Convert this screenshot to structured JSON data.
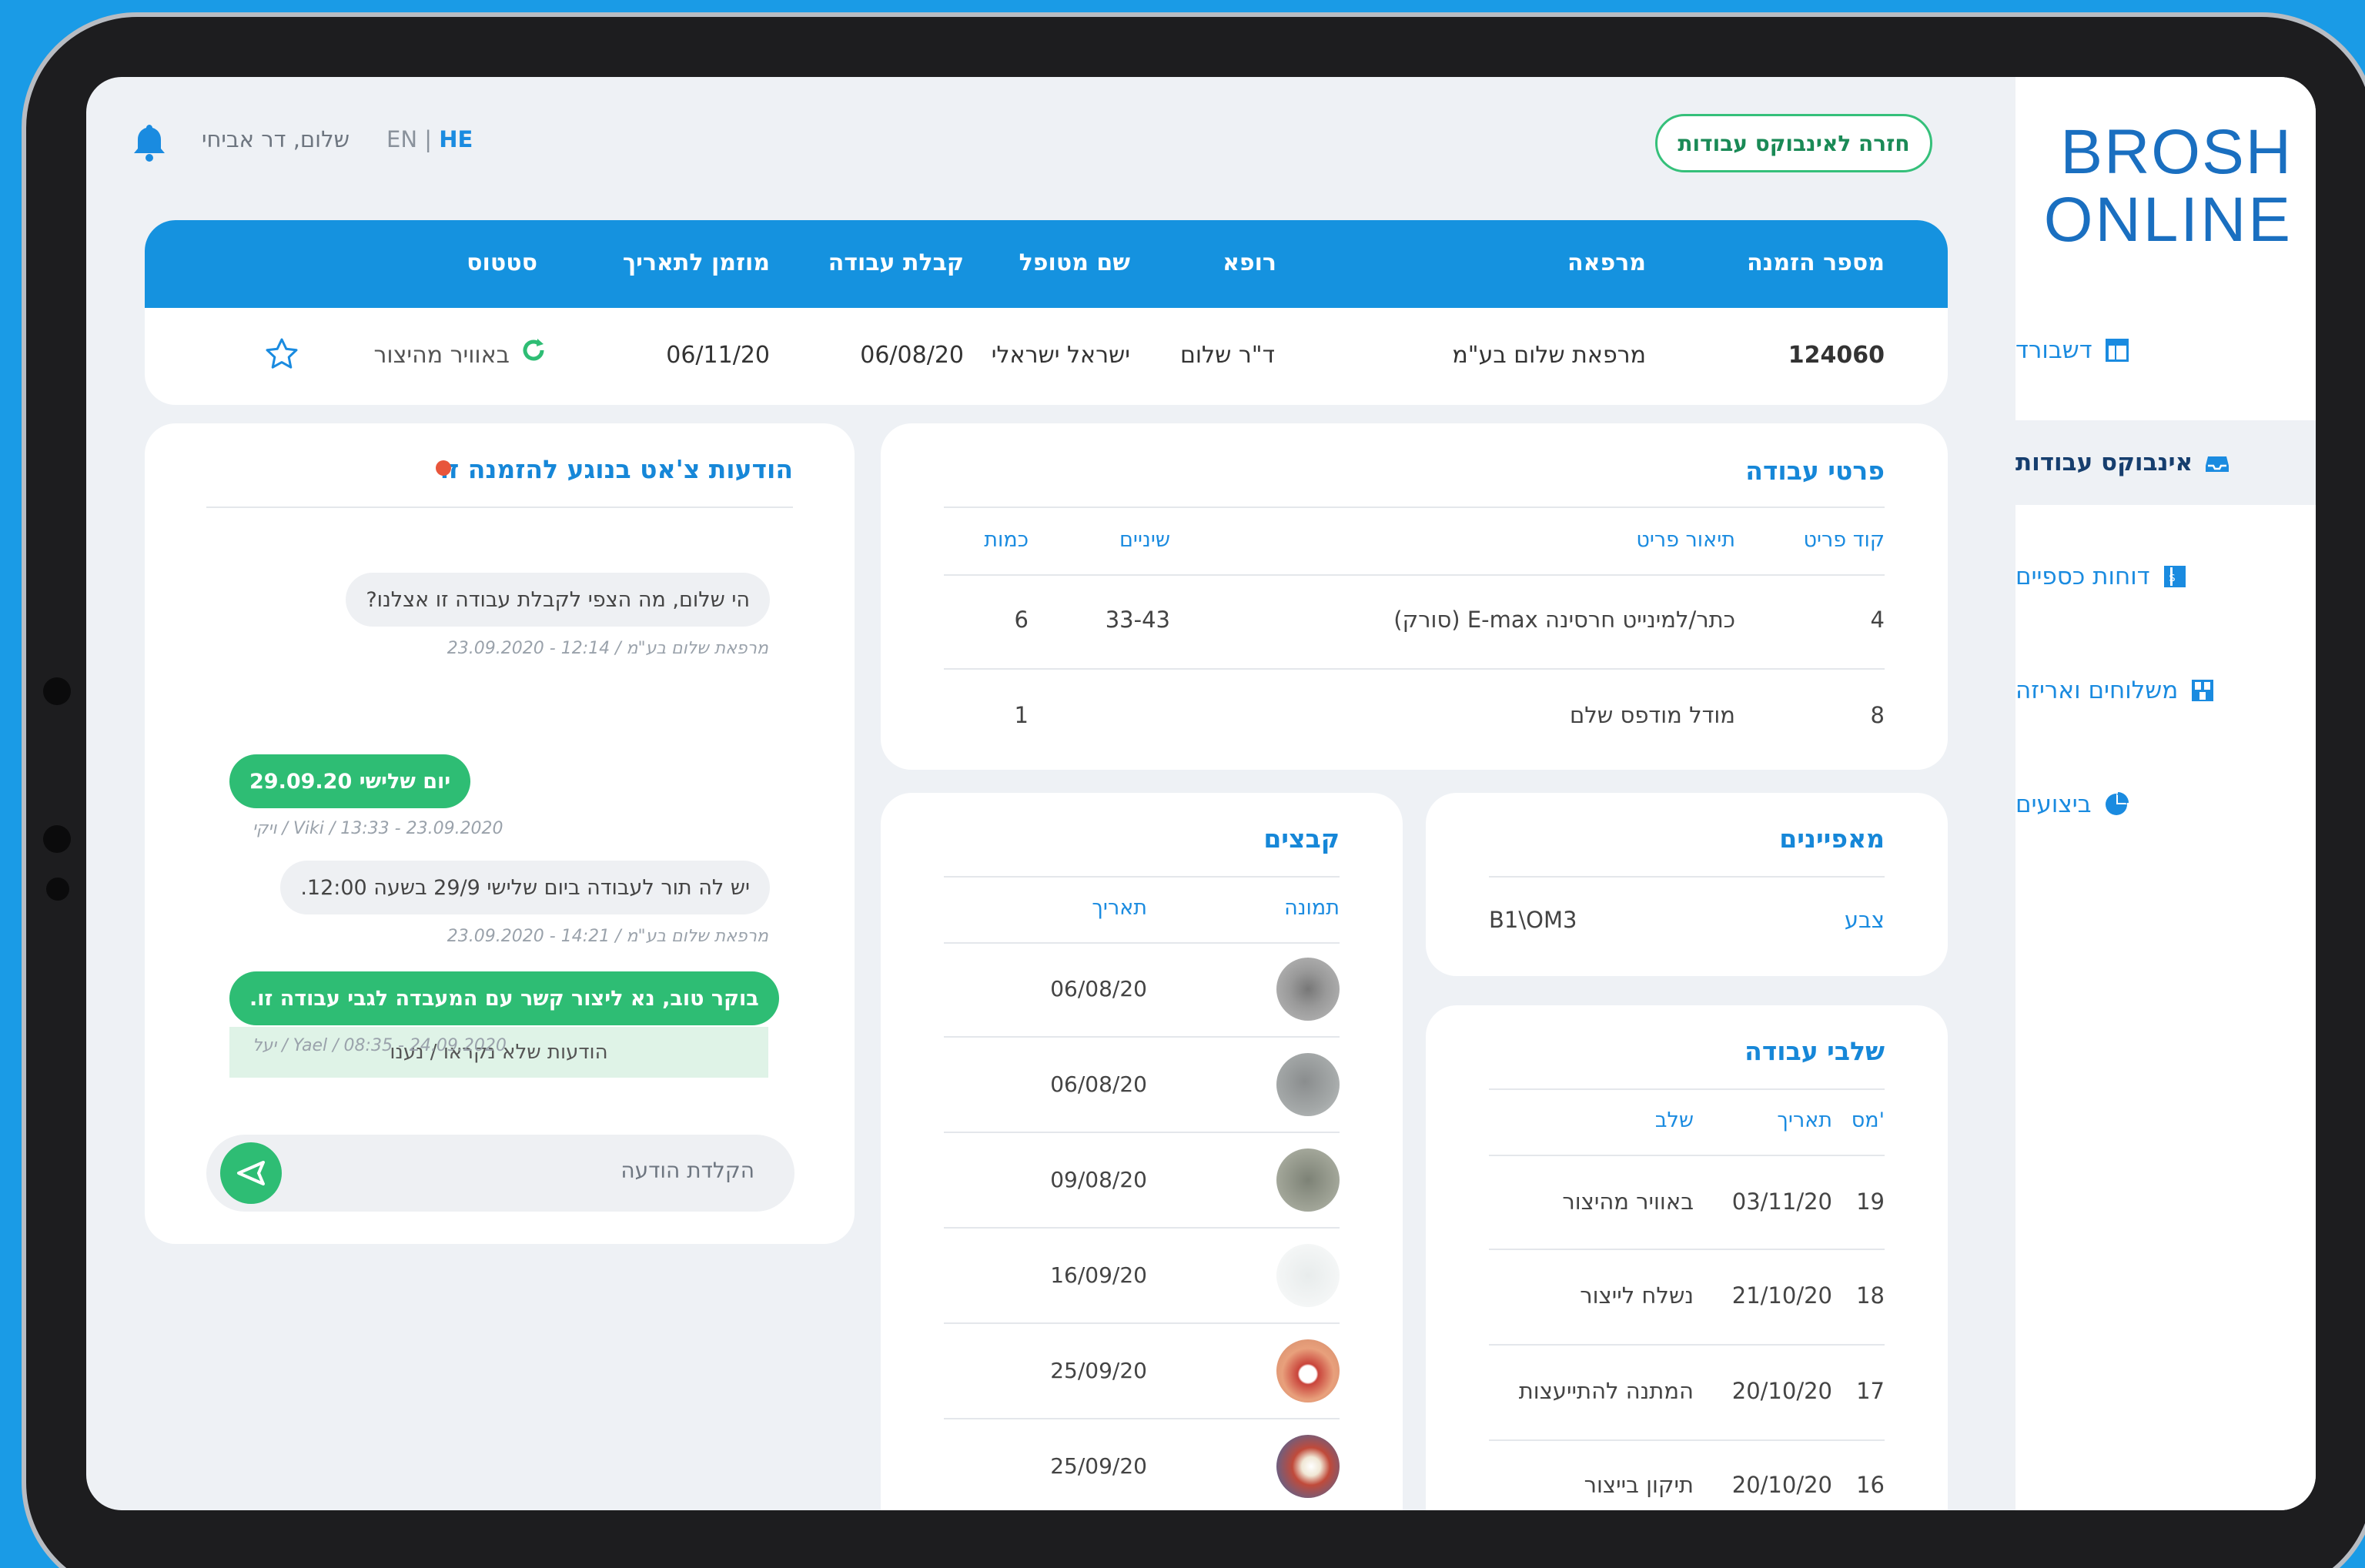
{
  "brand": {
    "line1": "BROSH",
    "line2": "ONLINE"
  },
  "sidebar": {
    "items": [
      {
        "label": "דשבורד",
        "icon": "dashboard-icon"
      },
      {
        "label": "אינבוקס עבודות",
        "icon": "inbox-icon"
      },
      {
        "label": "דוחות כספיים",
        "icon": "finance-report-icon"
      },
      {
        "label": "משלוחים ואריזה",
        "icon": "package-icon"
      },
      {
        "label": "ביצועים",
        "icon": "pie-chart-icon"
      }
    ]
  },
  "header": {
    "back_button": "חזרה לאינבוקס עבודות",
    "greeting": "שלום,  דר אביחי",
    "lang_en": "EN",
    "lang_sep": "|",
    "lang_he": "HE"
  },
  "order": {
    "columns": [
      "מספר הזמנה",
      "מרפאה",
      "רופא",
      "שם מטופל",
      "קבלת עבודה",
      "מוזמן לתאריך",
      "סטטוס"
    ],
    "order_number": "124060",
    "clinic": "מרפאת שלום בע\"מ",
    "doctor": "ד\"ר שלום",
    "patient": "ישראל ישראלי",
    "received": "06/08/20",
    "due": "06/11/20",
    "status": "באוויר מהיצור"
  },
  "work_details": {
    "title": "פרטי עבודה",
    "columns": [
      "קוד פריט",
      "תיאור פריט",
      "שיניים",
      "כמות"
    ],
    "rows": [
      {
        "code": "4",
        "desc": "כתר/למינייט חרסינה E-max (סורק)",
        "teeth": "33-43",
        "qty": "6"
      },
      {
        "code": "8",
        "desc": "מודל מודפס שלם",
        "teeth": "",
        "qty": "1"
      }
    ]
  },
  "properties": {
    "title": "מאפיינים",
    "label": "צבע",
    "value": "B1\\OM3"
  },
  "files": {
    "title": "קבצים",
    "columns": [
      "תמונה",
      "תאריך"
    ],
    "rows": [
      "06/08/20",
      "06/08/20",
      "09/08/20",
      "16/09/20",
      "25/09/20",
      "25/09/20"
    ]
  },
  "stages": {
    "title": "שלבי עבודה",
    "columns": [
      "מס'",
      "תאריך",
      "שלב"
    ],
    "rows": [
      {
        "num": "19",
        "date": "03/11/20",
        "stage": "באוויר מהיצור"
      },
      {
        "num": "18",
        "date": "21/10/20",
        "stage": "נשלח לייצור"
      },
      {
        "num": "17",
        "date": "20/10/20",
        "stage": "המתנה להתייעצות"
      },
      {
        "num": "16",
        "date": "20/10/20",
        "stage": "תיקון בייצור"
      }
    ]
  },
  "chat": {
    "title": "הודעות צ'אט בנוגע להזמנה זו",
    "messages": [
      {
        "text": "הי שלום, מה הצפי לקבלת עבודה זו אצלנו?",
        "meta": "מרפאת שלום בע\"מ / 12:14 - 23.09.2020"
      },
      {
        "text": "יום שלישי 29.09.20",
        "meta": "ויקי / Viki / 13:33 - 23.09.2020"
      },
      {
        "text": "יש לה תור לעבודה ביום שלישי 29/9 בשעה 12:00.",
        "meta": "מרפאת שלום בע\"מ / 14:21 - 23.09.2020"
      },
      {
        "text": "בוקר טוב, נא ליצור קשר עם המעבדה לגבי עבודה זו.",
        "meta": "יעל / Yael / 08:35 - 24.09.2020"
      }
    ],
    "unread": "הודעות שלא נקראו / נענו",
    "input_placeholder": "הקלדת הודעה"
  },
  "colors": {
    "primary": "#1592df",
    "accent_green": "#2ebd74",
    "alert_dot": "#e8553b"
  }
}
